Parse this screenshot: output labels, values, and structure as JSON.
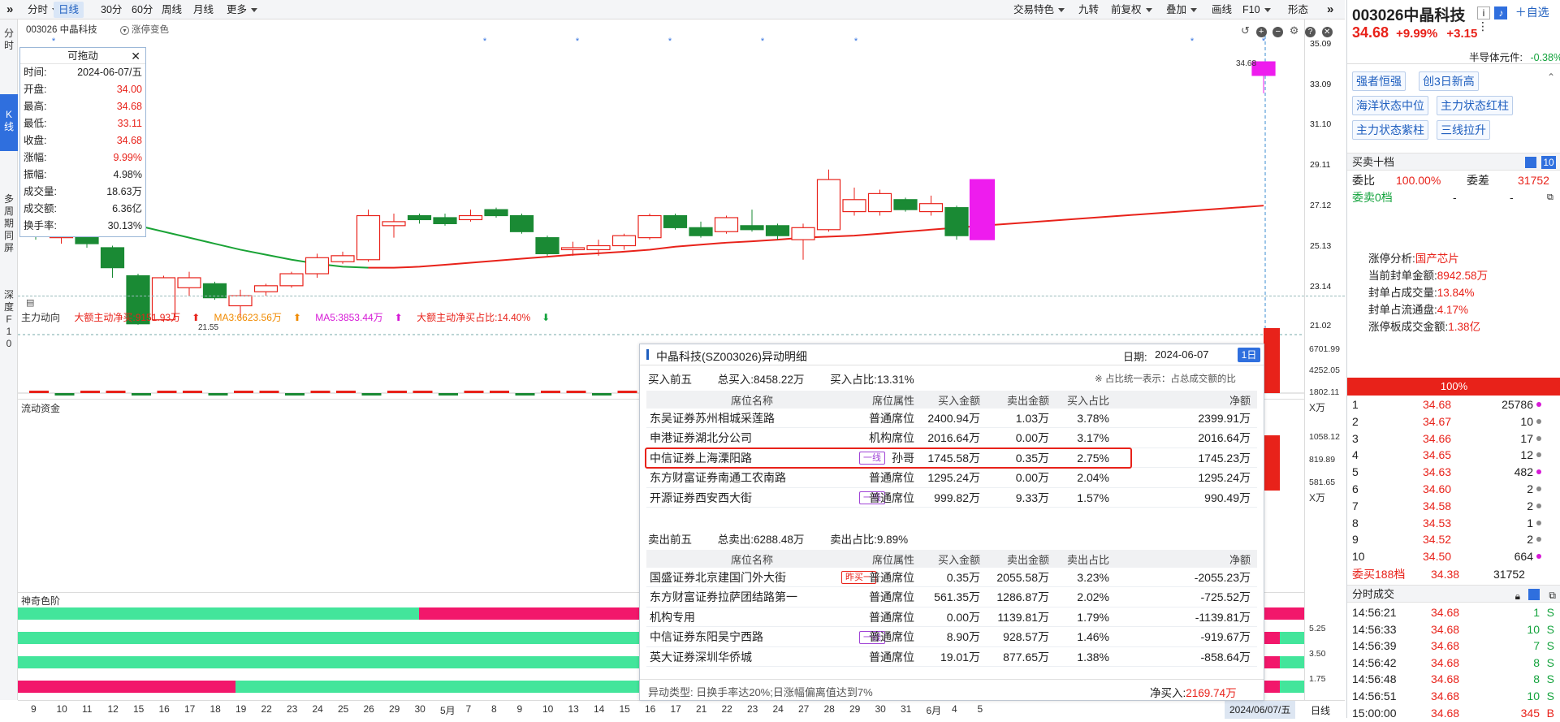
{
  "toolbar": {
    "items": [
      {
        "label": "分时",
        "caret": true
      },
      {
        "label": "日线",
        "active": true
      },
      {
        "label": "30分"
      },
      {
        "label": "60分"
      },
      {
        "label": "周线"
      },
      {
        "label": "月线"
      },
      {
        "label": "更多",
        "caret": true
      }
    ],
    "right_items": [
      {
        "label": "交易特色",
        "caret": true
      },
      {
        "label": "九转"
      },
      {
        "label": "前复权",
        "caret": true
      },
      {
        "label": "叠加",
        "caret": true
      },
      {
        "label": "画线"
      },
      {
        "label": "F10",
        "caret": true
      },
      {
        "label": "形态"
      }
    ]
  },
  "leftnav": {
    "items": [
      "分\n时",
      "K\n线",
      "多\n周\n期\n同\n屏",
      "深\n度\nF\n1\n0"
    ]
  },
  "main_chart": {
    "stock_label": "003026 中晶科技",
    "limit_toggle": "涨停变色",
    "price_axis": [
      "35.09",
      "33.09",
      "31.10",
      "29.11",
      "27.12",
      "25.13",
      "23.14",
      "21.02"
    ],
    "high_marker": "34.68",
    "low_marker": "21.55"
  },
  "popup": {
    "title": "可拖动",
    "rows": [
      {
        "label": "时间:",
        "value": "2024-06-07/五",
        "color": "normal"
      },
      {
        "label": "开盘:",
        "value": "34.00",
        "color": "red"
      },
      {
        "label": "最高:",
        "value": "34.68",
        "color": "red"
      },
      {
        "label": "最低:",
        "value": "33.11",
        "color": "red"
      },
      {
        "label": "收盘:",
        "value": "34.68",
        "color": "red"
      },
      {
        "label": "涨幅:",
        "value": "9.99%",
        "color": "red"
      },
      {
        "label": "振幅:",
        "value": "4.98%",
        "color": "normal"
      },
      {
        "label": "成交量:",
        "value": "18.63万",
        "color": "normal"
      },
      {
        "label": "成交额:",
        "value": "6.36亿",
        "color": "normal"
      },
      {
        "label": "换手率:",
        "value": "30.13%",
        "color": "normal"
      }
    ]
  },
  "indicator1": {
    "title": "主力动向",
    "items": [
      {
        "text": "大额主动净买:9151.93万",
        "color": "red",
        "arrow": "up"
      },
      {
        "text": "MA3:6623.56万",
        "color": "orange",
        "arrow": "up"
      },
      {
        "text": "MA5:3853.44万",
        "color": "magenta",
        "arrow": "up"
      },
      {
        "text": "大额主动净买占比:14.40%",
        "color": "red",
        "arrow": "down"
      }
    ],
    "axis": [
      "6701.99",
      "4252.05",
      "1802.11",
      "X万"
    ]
  },
  "indicator2": {
    "title": "流动资金",
    "axis": [
      "1058.12",
      "819.89",
      "581.65",
      "X万"
    ]
  },
  "indicator3": {
    "title": "神奇色阶",
    "axis": [
      "5.25",
      "3.50",
      "1.75"
    ]
  },
  "xaxis": {
    "labels": [
      "9",
      "10",
      "11",
      "12",
      "15",
      "16",
      "17",
      "18",
      "19",
      "22",
      "23",
      "24",
      "25",
      "26",
      "29",
      "30",
      "5月",
      "7",
      "8",
      "9",
      "10",
      "13",
      "14",
      "15",
      "16",
      "17",
      "21",
      "22",
      "23",
      "24",
      "27",
      "28",
      "29",
      "30",
      "31",
      "6月",
      "4",
      "5"
    ],
    "current_date": "2024/06/07/五",
    "period": "日线"
  },
  "detail": {
    "title": "中晶科技(SZ003026)异动明细",
    "date_label": "日期:",
    "date": "2024-06-07",
    "period_btn": "1日",
    "buy_section": {
      "title": "买入前五",
      "total_label": "总买入:",
      "total": "8458.22万",
      "ratio_label": "买入占比:",
      "ratio": "13.31%"
    },
    "note": "※ 占比统一表示：占总成交额的比",
    "buy_headers": [
      "席位名称",
      "席位属性",
      "买入金额",
      "卖出金额",
      "买入占比",
      "净额"
    ],
    "buy_rows": [
      {
        "name": "东吴证券苏州相城采莲路",
        "tag": "",
        "attr": "普通席位",
        "buy": "2400.94万",
        "sell": "1.03万",
        "pct": "3.78%",
        "net": "2399.91万"
      },
      {
        "name": "申港证券湖北分公司",
        "tag": "",
        "attr": "机构席位",
        "buy": "2016.64万",
        "sell": "0.00万",
        "pct": "3.17%",
        "net": "2016.64万"
      },
      {
        "name": "中信证券上海溧阳路",
        "tag": "一线",
        "attr": "孙哥",
        "buy": "1745.58万",
        "sell": "0.35万",
        "pct": "2.75%",
        "net": "1745.23万"
      },
      {
        "name": "东方财富证券南通工农南路",
        "tag": "",
        "attr": "普通席位",
        "buy": "1295.24万",
        "sell": "0.00万",
        "pct": "2.04%",
        "net": "1295.24万"
      },
      {
        "name": "开源证券西安西大街",
        "tag": "一线",
        "attr": "普通席位",
        "buy": "999.82万",
        "sell": "9.33万",
        "pct": "1.57%",
        "net": "990.49万"
      }
    ],
    "sell_section": {
      "title": "卖出前五",
      "total_label": "总卖出:",
      "total": "6288.48万",
      "ratio_label": "卖出占比:",
      "ratio": "9.89%"
    },
    "sell_headers": [
      "席位名称",
      "席位属性",
      "买入金额",
      "卖出金额",
      "卖出占比",
      "净额"
    ],
    "sell_rows": [
      {
        "name": "国盛证券北京建国门外大街",
        "tag": "昨买一",
        "attr": "普通席位",
        "buy": "0.35万",
        "sell": "2055.58万",
        "pct": "3.23%",
        "net": "-2055.23万"
      },
      {
        "name": "东方财富证券拉萨团结路第一",
        "tag": "",
        "attr": "普通席位",
        "buy": "561.35万",
        "sell": "1286.87万",
        "pct": "2.02%",
        "net": "-725.52万"
      },
      {
        "name": "机构专用",
        "tag": "",
        "attr": "普通席位",
        "buy": "0.00万",
        "sell": "1139.81万",
        "pct": "1.79%",
        "net": "-1139.81万"
      },
      {
        "name": "中信证券东阳吴宁西路",
        "tag": "一线",
        "attr": "普通席位",
        "buy": "8.90万",
        "sell": "928.57万",
        "pct": "1.46%",
        "net": "-919.67万"
      },
      {
        "name": "英大证券深圳华侨城",
        "tag": "",
        "attr": "普通席位",
        "buy": "19.01万",
        "sell": "877.65万",
        "pct": "1.38%",
        "net": "-858.64万"
      }
    ],
    "footer_type": "异动类型: 日换手率达20%;日涨幅偏离值达到7%",
    "footer_net_label": "净买入:",
    "footer_net": "2169.74万"
  },
  "right": {
    "code": "003026",
    "name": "中晶科技",
    "add_btn": "自选",
    "price": "34.68",
    "change_pct": "+9.99%",
    "change": "+3.15",
    "sector": "半导体元件:",
    "sector_pct": "-0.38%",
    "chips": [
      "强者恒强",
      "创3日新高",
      "海洋状态中位",
      "主力状态红柱",
      "主力状态紫柱",
      "三线拉升"
    ],
    "depth_title": "买卖十档",
    "depth_level": "10",
    "weibi_label": "委比",
    "weibi": "100.00%",
    "weicha_label": "委差",
    "weicha": "31752",
    "weimai_label": "委卖0档",
    "weimai_a": "-",
    "weimai_b": "-",
    "limit_analysis": {
      "title": "涨停分析:",
      "concept": "国产芯片",
      "rows": [
        {
          "label": "当前封单金额:",
          "value": "8942.58万"
        },
        {
          "label": "封单占成交量:",
          "value": "13.84%"
        },
        {
          "label": "封单占流通盘:",
          "value": "4.17%"
        },
        {
          "label": "涨停板成交金额:",
          "value": "1.38亿"
        }
      ]
    },
    "bar_label": "100%",
    "orderbook": [
      {
        "lvl": "1",
        "price": "34.68",
        "vol": "25786",
        "dot": "magenta"
      },
      {
        "lvl": "2",
        "price": "34.67",
        "vol": "10",
        "dot": "gray"
      },
      {
        "lvl": "3",
        "price": "34.66",
        "vol": "17",
        "dot": "gray"
      },
      {
        "lvl": "4",
        "price": "34.65",
        "vol": "12",
        "dot": "gray"
      },
      {
        "lvl": "5",
        "price": "34.63",
        "vol": "482",
        "dot": "magenta"
      },
      {
        "lvl": "6",
        "price": "34.60",
        "vol": "2",
        "dot": "gray"
      },
      {
        "lvl": "7",
        "price": "34.58",
        "vol": "2",
        "dot": "gray"
      },
      {
        "lvl": "8",
        "price": "34.53",
        "vol": "1",
        "dot": "gray"
      },
      {
        "lvl": "9",
        "price": "34.52",
        "vol": "2",
        "dot": "gray"
      },
      {
        "lvl": "10",
        "price": "34.50",
        "vol": "664",
        "dot": "magenta"
      }
    ],
    "weimai2_label": "委买188档",
    "weimai2_price": "34.38",
    "weimai2_vol": "31752",
    "trades_title": "分时成交",
    "trades": [
      {
        "time": "14:56:21",
        "price": "34.68",
        "vol": "1",
        "side": "S"
      },
      {
        "time": "14:56:33",
        "price": "34.68",
        "vol": "10",
        "side": "S"
      },
      {
        "time": "14:56:39",
        "price": "34.68",
        "vol": "7",
        "side": "S"
      },
      {
        "time": "14:56:42",
        "price": "34.68",
        "vol": "8",
        "side": "S"
      },
      {
        "time": "14:56:48",
        "price": "34.68",
        "vol": "8",
        "side": "S"
      },
      {
        "time": "14:56:51",
        "price": "34.68",
        "vol": "10",
        "side": "S"
      },
      {
        "time": "15:00:00",
        "price": "34.68",
        "vol": "345",
        "side": "B"
      }
    ]
  },
  "chart_data": {
    "type": "candlestick",
    "x": [
      "9",
      "10",
      "11",
      "12",
      "15",
      "16",
      "17",
      "18",
      "19",
      "22",
      "23",
      "24",
      "25",
      "26",
      "29",
      "30",
      "5月",
      "7",
      "8",
      "9",
      "10",
      "13",
      "14",
      "15",
      "16",
      "17",
      "21",
      "22",
      "23",
      "24",
      "27",
      "28",
      "29",
      "30",
      "31",
      "6月",
      "4",
      "5",
      "6/07"
    ],
    "ylim": [
      21.02,
      35.09
    ],
    "candles": [
      {
        "o": 27.0,
        "c": 26.0,
        "h": 27.2,
        "l": 25.8
      },
      {
        "o": 25.9,
        "c": 26.0,
        "h": 26.4,
        "l": 25.6
      },
      {
        "o": 26.2,
        "c": 25.6,
        "h": 26.6,
        "l": 25.4
      },
      {
        "o": 25.4,
        "c": 24.4,
        "h": 25.5,
        "l": 23.9
      },
      {
        "o": 24.0,
        "c": 21.6,
        "h": 24.1,
        "l": 21.55
      },
      {
        "o": 21.8,
        "c": 23.9,
        "h": 24.0,
        "l": 21.7
      },
      {
        "o": 23.4,
        "c": 23.9,
        "h": 24.2,
        "l": 23.0
      },
      {
        "o": 23.6,
        "c": 22.9,
        "h": 23.7,
        "l": 22.8
      },
      {
        "o": 22.5,
        "c": 23.0,
        "h": 23.3,
        "l": 21.9
      },
      {
        "o": 23.2,
        "c": 23.5,
        "h": 23.6,
        "l": 23.0
      },
      {
        "o": 23.5,
        "c": 24.1,
        "h": 24.2,
        "l": 23.4
      },
      {
        "o": 24.1,
        "c": 24.9,
        "h": 25.1,
        "l": 23.9
      },
      {
        "o": 24.7,
        "c": 25.0,
        "h": 25.2,
        "l": 24.6
      },
      {
        "o": 24.8,
        "c": 27.0,
        "h": 27.3,
        "l": 24.7
      },
      {
        "o": 26.5,
        "c": 26.7,
        "h": 27.1,
        "l": 25.9
      },
      {
        "o": 27.0,
        "c": 26.8,
        "h": 27.1,
        "l": 26.6
      },
      {
        "o": 26.9,
        "c": 26.6,
        "h": 27.1,
        "l": 26.5
      },
      {
        "o": 26.8,
        "c": 27.0,
        "h": 27.3,
        "l": 26.7
      },
      {
        "o": 27.3,
        "c": 27.0,
        "h": 27.4,
        "l": 26.9
      },
      {
        "o": 27.0,
        "c": 26.2,
        "h": 27.1,
        "l": 26.1
      },
      {
        "o": 25.9,
        "c": 25.1,
        "h": 26.0,
        "l": 25.0
      },
      {
        "o": 25.3,
        "c": 25.4,
        "h": 25.7,
        "l": 25.0
      },
      {
        "o": 25.3,
        "c": 25.5,
        "h": 25.8,
        "l": 25.0
      },
      {
        "o": 25.5,
        "c": 26.0,
        "h": 26.1,
        "l": 25.3
      },
      {
        "o": 25.9,
        "c": 27.0,
        "h": 27.1,
        "l": 25.8
      },
      {
        "o": 27.0,
        "c": 26.4,
        "h": 27.1,
        "l": 26.3
      },
      {
        "o": 26.4,
        "c": 26.0,
        "h": 26.7,
        "l": 25.9
      },
      {
        "o": 26.2,
        "c": 26.9,
        "h": 27.0,
        "l": 26.1
      },
      {
        "o": 26.5,
        "c": 26.3,
        "h": 27.3,
        "l": 26.2
      },
      {
        "o": 26.5,
        "c": 26.0,
        "h": 26.6,
        "l": 25.8
      },
      {
        "o": 25.8,
        "c": 26.4,
        "h": 26.6,
        "l": 24.8
      },
      {
        "o": 26.3,
        "c": 28.8,
        "h": 29.3,
        "l": 26.2
      },
      {
        "o": 27.2,
        "c": 27.8,
        "h": 28.4,
        "l": 27.0
      },
      {
        "o": 27.2,
        "c": 28.1,
        "h": 28.3,
        "l": 27.0
      },
      {
        "o": 27.8,
        "c": 27.3,
        "h": 27.9,
        "l": 27.2
      },
      {
        "o": 27.2,
        "c": 27.6,
        "h": 28.0,
        "l": 27.0
      },
      {
        "o": 27.4,
        "c": 26.0,
        "h": 27.5,
        "l": 25.8
      },
      {
        "o": 25.8,
        "c": 28.8,
        "h": 28.8,
        "l": 25.8
      },
      {
        "o": 34.0,
        "c": 34.68,
        "h": 34.68,
        "l": 33.11
      }
    ],
    "ma_series": {
      "name": "MA",
      "values": [
        27.5,
        27.3,
        27.1,
        26.8,
        26.5,
        26.2,
        25.9,
        25.6,
        25.3,
        25.05,
        24.8,
        24.6,
        24.45,
        24.4,
        24.4,
        24.45,
        24.55,
        24.65,
        24.75,
        24.85,
        24.95,
        25.05,
        25.12,
        25.2,
        25.3,
        25.45,
        25.55,
        25.65,
        25.72,
        25.8,
        25.9,
        25.95,
        26.0,
        26.1,
        26.2,
        26.3,
        26.4,
        26.5,
        27.5
      ]
    }
  }
}
